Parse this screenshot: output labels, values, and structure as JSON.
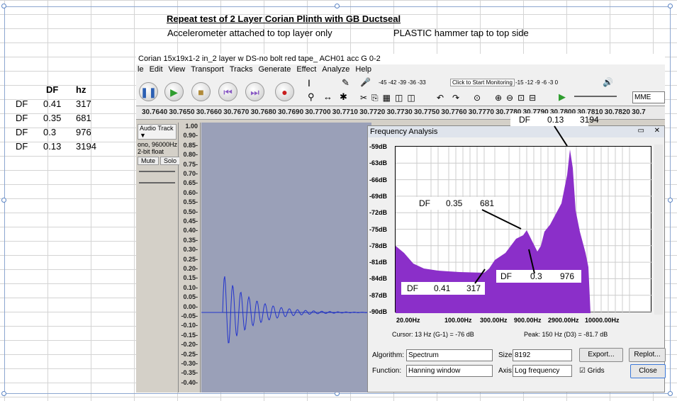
{
  "sheet": {
    "title": "Repeat test of 2 Layer Corian Plinth with GB Ductseal",
    "note1": "Accelerometer attached to top layer only",
    "note2": "PLASTIC hammer tap to top side",
    "table_headers": [
      "DF",
      "hz"
    ],
    "table_rows": [
      {
        "label": "DF",
        "df": "0.41",
        "hz": "317"
      },
      {
        "label": "DF",
        "df": "0.35",
        "hz": "681"
      },
      {
        "label": "DF",
        "df": "0.3",
        "hz": "976"
      },
      {
        "label": "DF",
        "df": "0.13",
        "hz": "3194"
      }
    ]
  },
  "audacity": {
    "title": "Corian 15x19x1-2 in_2 layer w DS-no bolt red tape_ ACH01 acc G 0-2",
    "menu": [
      "le",
      "Edit",
      "View",
      "Transport",
      "Tracks",
      "Generate",
      "Effect",
      "Analyze",
      "Help"
    ],
    "monitor_label": "Click to Start Monitoring",
    "meter_ticks": "-45 -42 -39 -36 -33",
    "meter_ticks2": "-15 -12 -9 -6 -3 0",
    "device": "MME",
    "timeline": [
      "30.7640",
      "30.7650",
      "30.7660",
      "30.7670",
      "30.7680",
      "30.7690",
      "30.7700",
      "30.7710",
      "30.7720",
      "30.7730",
      "30.7750",
      "30.7760",
      "30.7770",
      "30.7780",
      "30.7790",
      "30.7800",
      "30.7810",
      "30.7820",
      "30.7"
    ],
    "track_name": "Audio Track",
    "track_info1": "ono, 96000Hz",
    "track_info2": "2-bit float",
    "mute": "Mute",
    "solo": "Solo",
    "y_ticks": [
      "1.00",
      "0.90-",
      "0.85-",
      "0.80-",
      "0.75-",
      "0.70-",
      "0.65-",
      "0.60-",
      "0.55-",
      "0.50-",
      "0.45-",
      "0.40-",
      "0.35-",
      "0.30-",
      "0.25-",
      "0.20-",
      "0.15-",
      "0.10-",
      "0.05-",
      "0.00-",
      "-0.05-",
      "-0.10-",
      "-0.15-",
      "-0.20-",
      "-0.25-",
      "-0.30-",
      "-0.35-",
      "-0.40-"
    ]
  },
  "freq": {
    "title": "Frequency Analysis",
    "y_labels": [
      "-59dB",
      "-63dB",
      "-66dB",
      "-69dB",
      "-72dB",
      "-75dB",
      "-78dB",
      "-81dB",
      "-84dB",
      "-87dB",
      "-90dB"
    ],
    "x_labels": [
      "20.00Hz",
      "100.00Hz",
      "300.00Hz",
      "900.00Hz",
      "2900.00Hz",
      "10000.00Hz"
    ],
    "cursor": "Cursor: 13 Hz (G-1) = -76 dB",
    "peak": "Peak: 150 Hz (D3) = -81.7 dB",
    "algorithm_label": "Algorithm:",
    "algorithm_value": "Spectrum",
    "size_label": "Size:",
    "size_value": "8192",
    "function_label": "Function:",
    "function_value": "Hanning window",
    "axis_label": "Axis:",
    "axis_value": "Log frequency",
    "grids_label": "Grids",
    "export": "Export...",
    "replot": "Replot...",
    "close": "Close"
  },
  "callouts": [
    {
      "label": "DF",
      "df": "0.13",
      "hz": "3194"
    },
    {
      "label": "DF",
      "df": "0.35",
      "hz": "681"
    },
    {
      "label": "DF",
      "df": "0.3",
      "hz": "976"
    },
    {
      "label": "DF",
      "df": "0.41",
      "hz": "317"
    }
  ],
  "colors": {
    "spectrum": "#8b2fc9",
    "accent": "#5b84c4"
  }
}
